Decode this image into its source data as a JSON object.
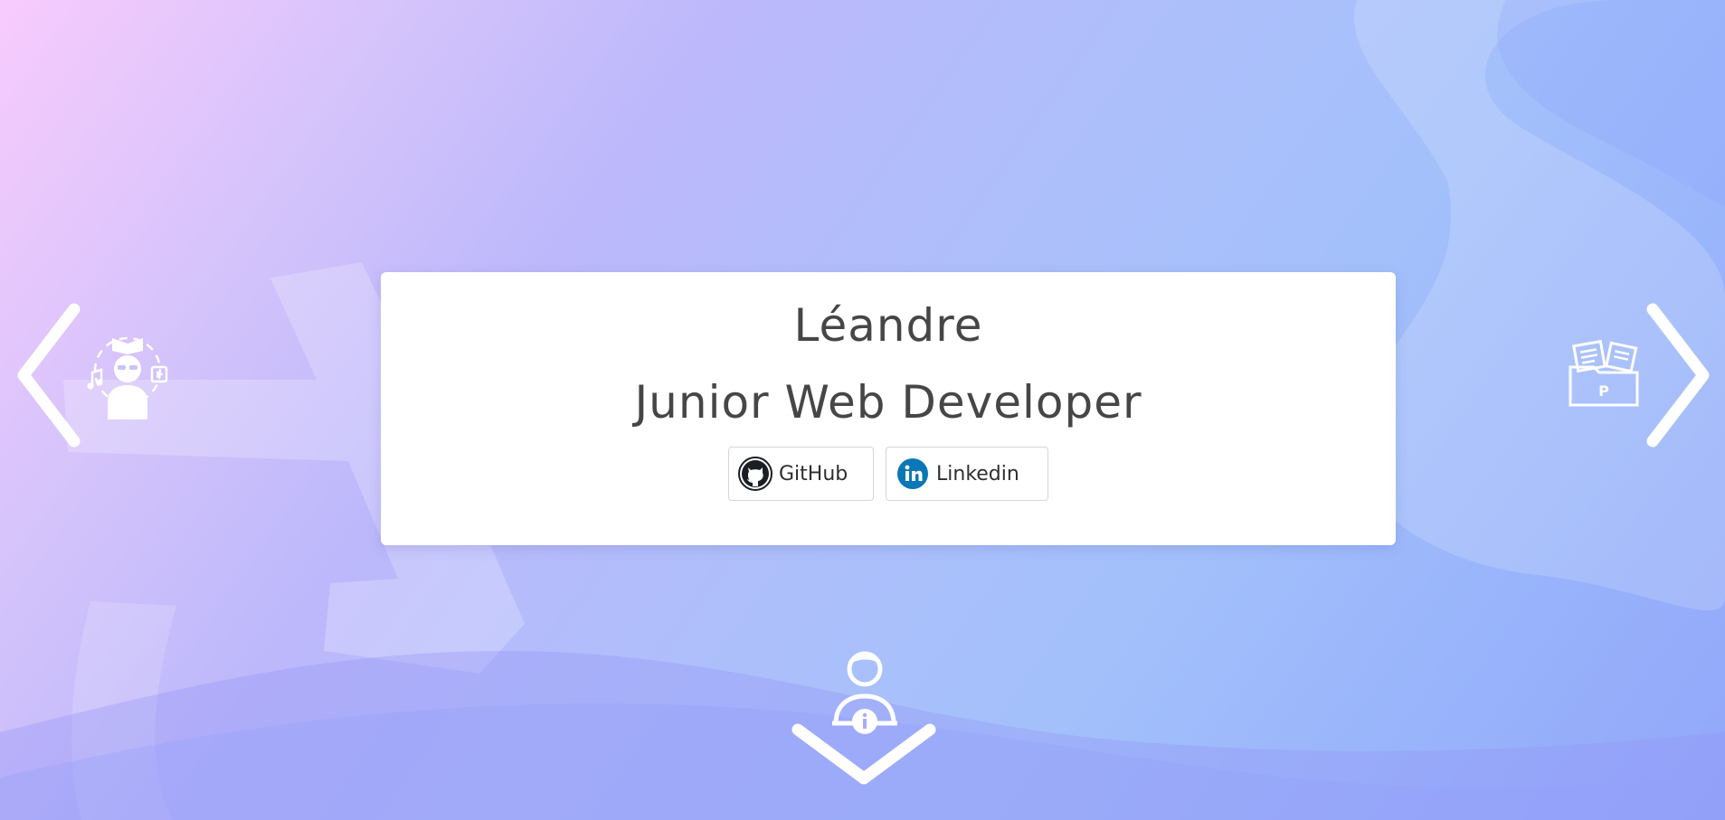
{
  "profile": {
    "name": "Léandre",
    "role": "Junior Web Developer"
  },
  "links": {
    "github_label": "GitHub",
    "linkedin_label": "Linkedin"
  },
  "icons": {
    "left_section": "student-media-icon",
    "right_section": "portfolio-folder-icon",
    "bottom_section": "profile-info-icon",
    "nav_left": "chevron-left-icon",
    "nav_right": "chevron-right-icon",
    "nav_down": "chevron-down-icon"
  },
  "colors": {
    "card_text": "#464646",
    "linkedin_brand": "#0a77b6",
    "github_brand": "#1b1f23",
    "nav_icons": "#ffffff"
  }
}
